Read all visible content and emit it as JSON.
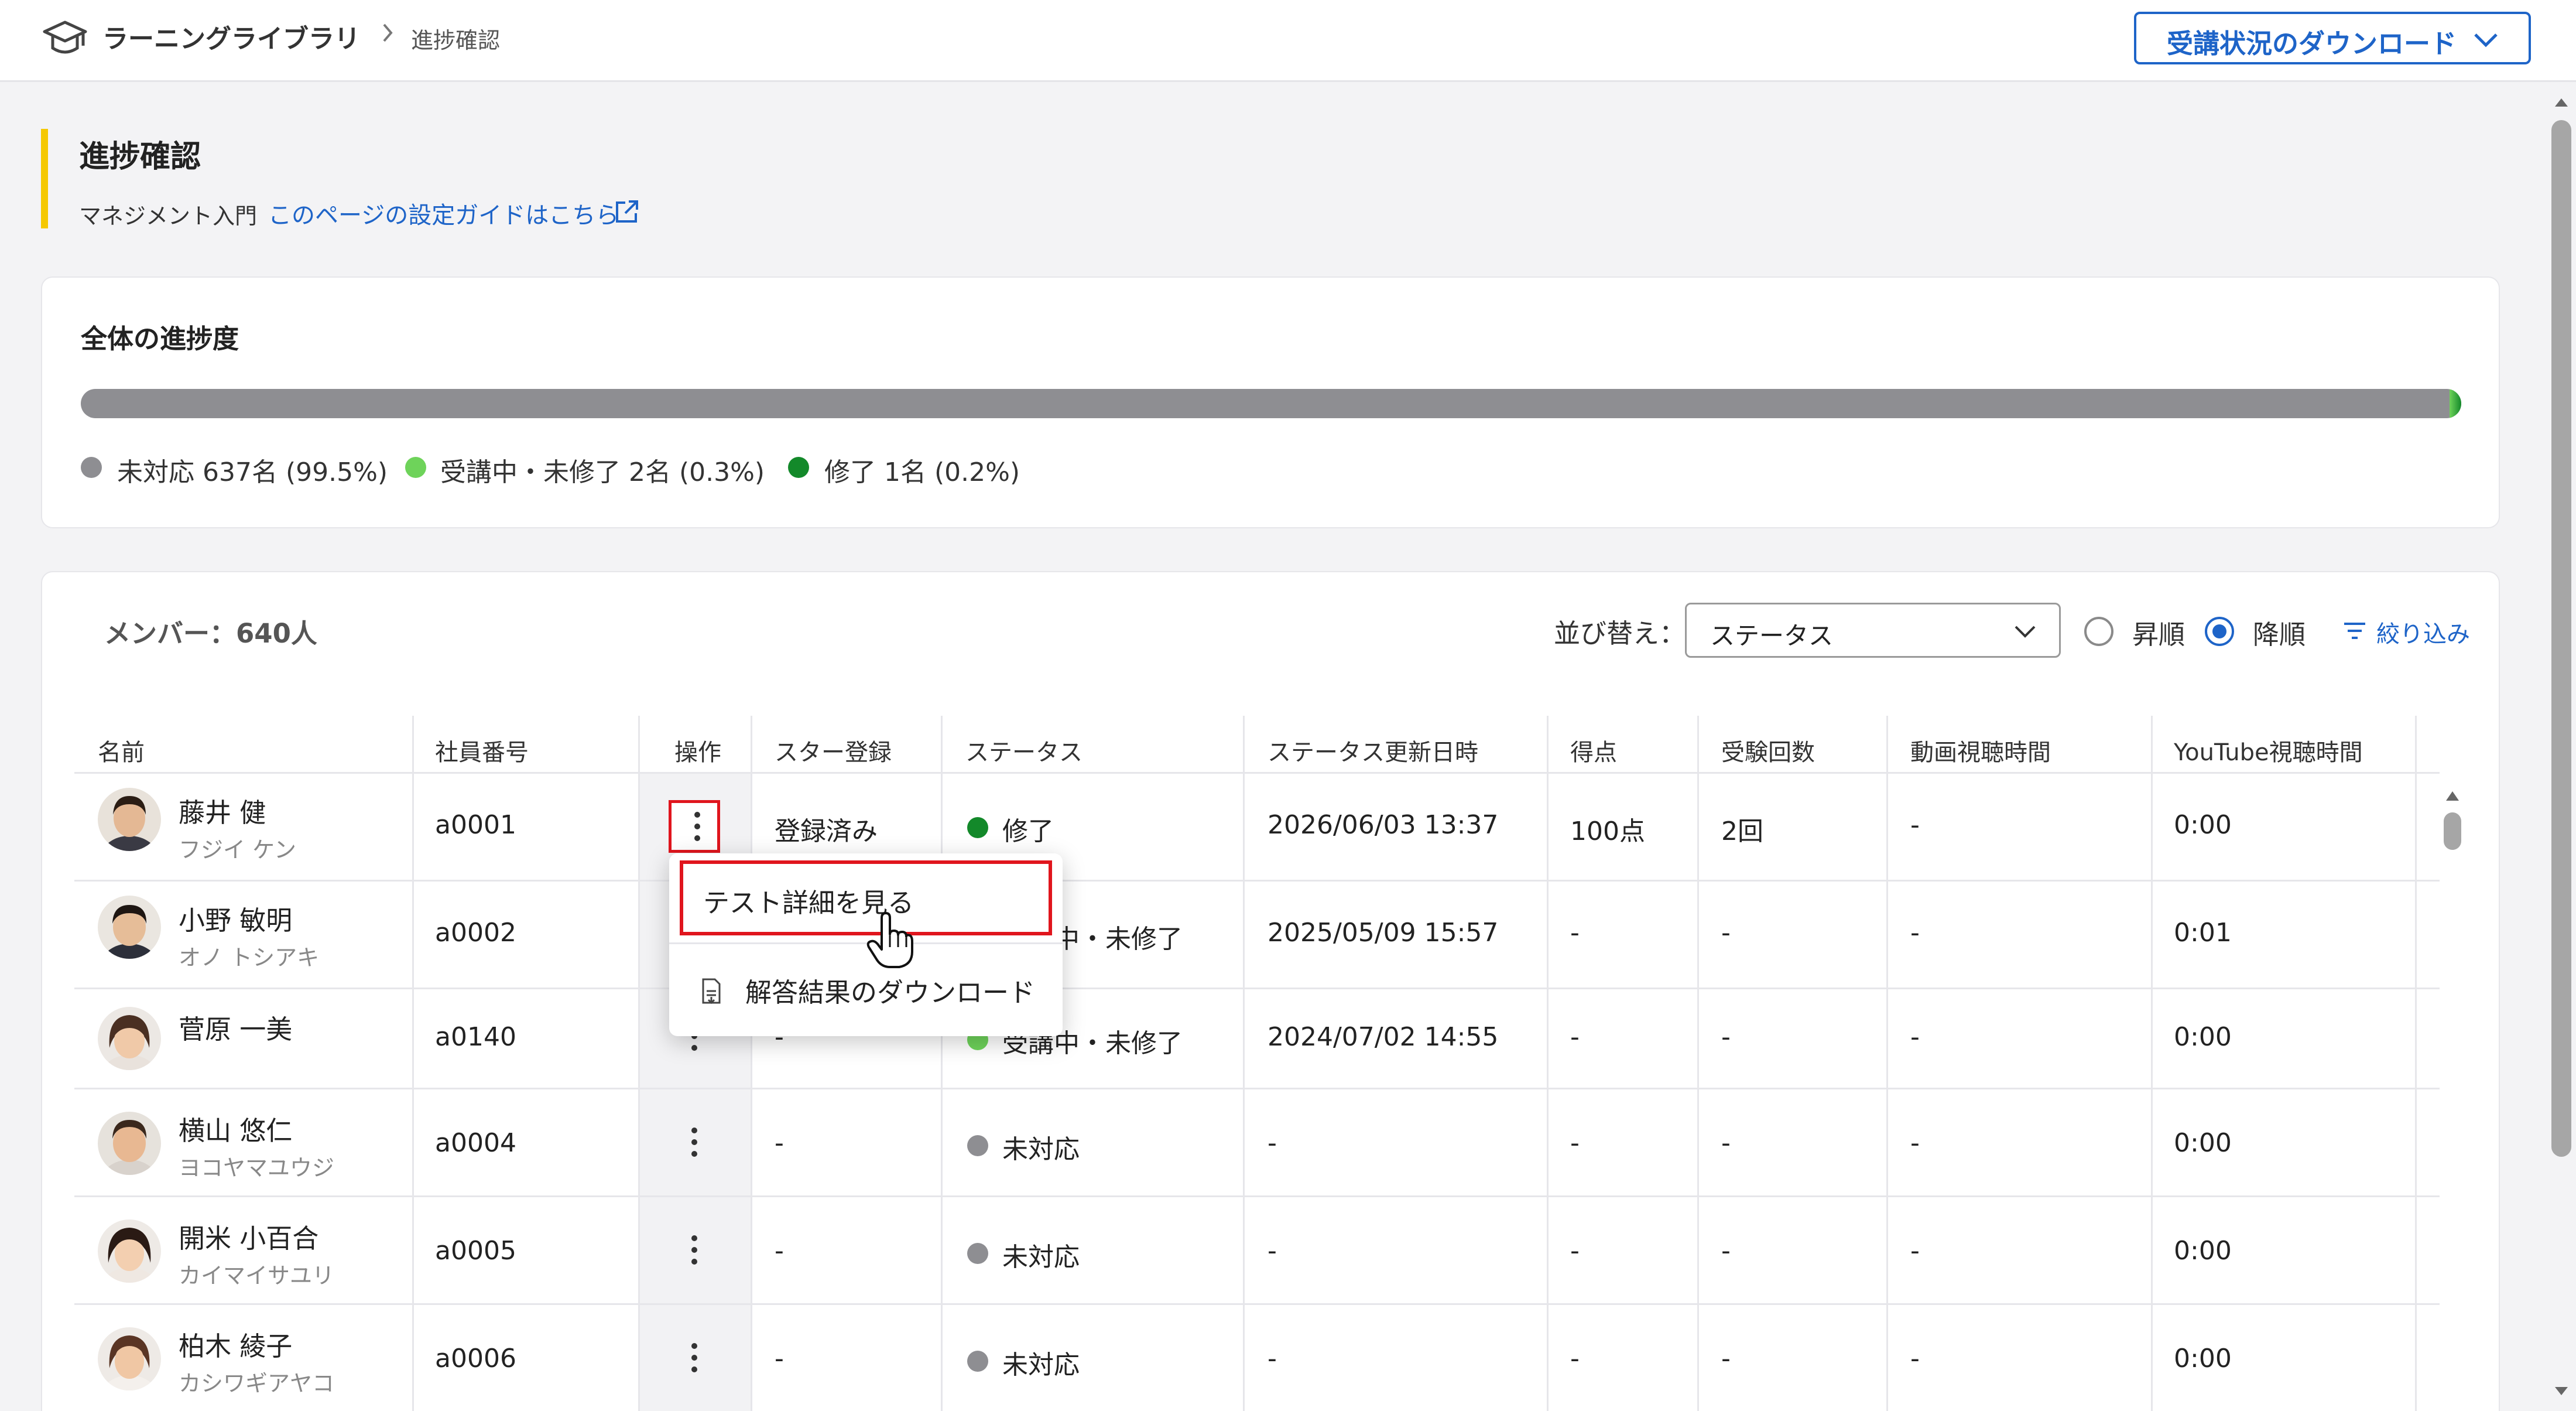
{
  "header": {
    "breadcrumb_root": "ラーニングライブラリ",
    "breadcrumb_current": "進捗確認",
    "download_button": "受講状況のダウンロード"
  },
  "page": {
    "title": "進捗確認",
    "course_name": "マネジメント入門",
    "guide_link": "このページの設定ガイドはこちら"
  },
  "progress": {
    "title": "全体の進捗度",
    "segments": [
      {
        "label": "未対応 637名 (99.5%)",
        "fraction": 0.995,
        "color": "#8e8e92"
      },
      {
        "label": "受講中・未修了 2名 (0.3%)",
        "fraction": 0.003,
        "color": "#6ed35a"
      },
      {
        "label": "修了 1名 (0.2%)",
        "fraction": 0.002,
        "color": "#13892a"
      }
    ]
  },
  "members": {
    "count_label": "メンバー：640人",
    "sort_label": "並び替え：",
    "sort_value": "ステータス",
    "asc_label": "昇順",
    "desc_label": "降順",
    "filter_label": "絞り込み",
    "columns": [
      "名前",
      "社員番号",
      "操作",
      "スター登録",
      "ステータス",
      "ステータス更新日時",
      "得点",
      "受験回数",
      "動画視聴時間",
      "YouTube視聴時間"
    ],
    "rows": [
      {
        "name": "藤井 健",
        "kana": "フジイ ケン",
        "id": "a0001",
        "star": "登録済み",
        "status": "修了",
        "status_color": "#13892a",
        "updated": "2026/06/03 13:37",
        "score": "100点",
        "attempts": "2回",
        "video": "-",
        "youtube": "0:00"
      },
      {
        "name": "小野 敏明",
        "kana": "オノ トシアキ",
        "id": "a0002",
        "star": "-",
        "status": "受講中・未修了",
        "status_color": "#6ed35a",
        "updated": "2025/05/09 15:57",
        "score": "-",
        "attempts": "-",
        "video": "-",
        "youtube": "0:01"
      },
      {
        "name": "菅原 一美",
        "kana": "",
        "id": "a0140",
        "star": "-",
        "status": "受講中・未修了",
        "status_color": "#6ed35a",
        "updated": "2024/07/02 14:55",
        "score": "-",
        "attempts": "-",
        "video": "-",
        "youtube": "0:00"
      },
      {
        "name": "横山 悠仁",
        "kana": "ヨコヤマユウジ",
        "id": "a0004",
        "star": "-",
        "status": "未対応",
        "status_color": "#8e8e92",
        "updated": "-",
        "score": "-",
        "attempts": "-",
        "video": "-",
        "youtube": "0:00"
      },
      {
        "name": "開米 小百合",
        "kana": "カイマイサユリ",
        "id": "a0005",
        "star": "-",
        "status": "未対応",
        "status_color": "#8e8e92",
        "updated": "-",
        "score": "-",
        "attempts": "-",
        "video": "-",
        "youtube": "0:00"
      },
      {
        "name": "柏木 綾子",
        "kana": "カシワギアヤコ",
        "id": "a0006",
        "star": "-",
        "status": "未対応",
        "status_color": "#8e8e92",
        "updated": "-",
        "score": "-",
        "attempts": "-",
        "video": "-",
        "youtube": "0:00"
      }
    ]
  },
  "menu": {
    "view_test_details": "テスト詳細を見る",
    "download_answers": "解答結果のダウンロード"
  },
  "colors": {
    "accent": "#1e64c8",
    "highlight_red": "#e0151d",
    "title_bar": "#f5c800"
  }
}
